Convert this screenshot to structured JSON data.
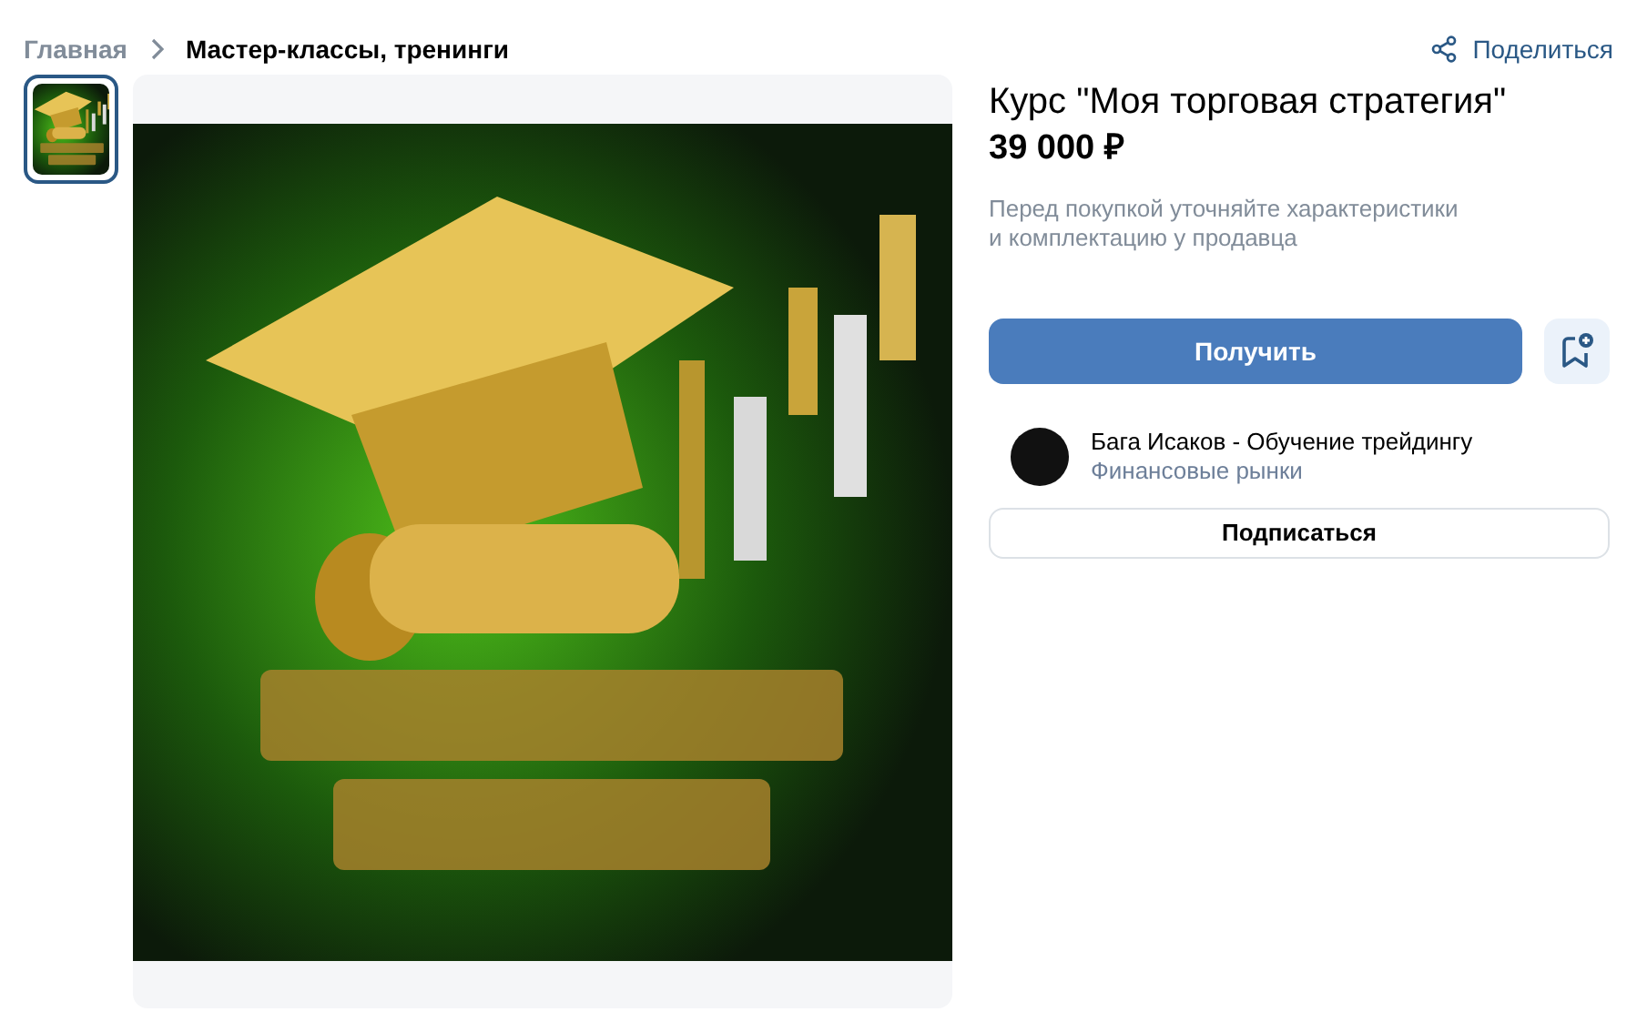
{
  "breadcrumbs": [
    {
      "label": "Главная",
      "current": false
    },
    {
      "label": "Мастер-классы, тренинги",
      "current": true
    }
  ],
  "share": {
    "label": "Поделиться"
  },
  "gallery": {
    "thumbnails": [
      {
        "selected": true
      }
    ]
  },
  "product": {
    "title": "Курс \"Моя торговая стратегия\"",
    "price": "39 000 ₽",
    "note": "Перед покупкой уточняйте характеристики\nи комплектацию у продавца"
  },
  "actions": {
    "primary": "Получить"
  },
  "seller": {
    "name": "Бага Исаков - Обучение трейдингу",
    "category": "Финансовые рынки",
    "subscribe": "Подписаться"
  }
}
